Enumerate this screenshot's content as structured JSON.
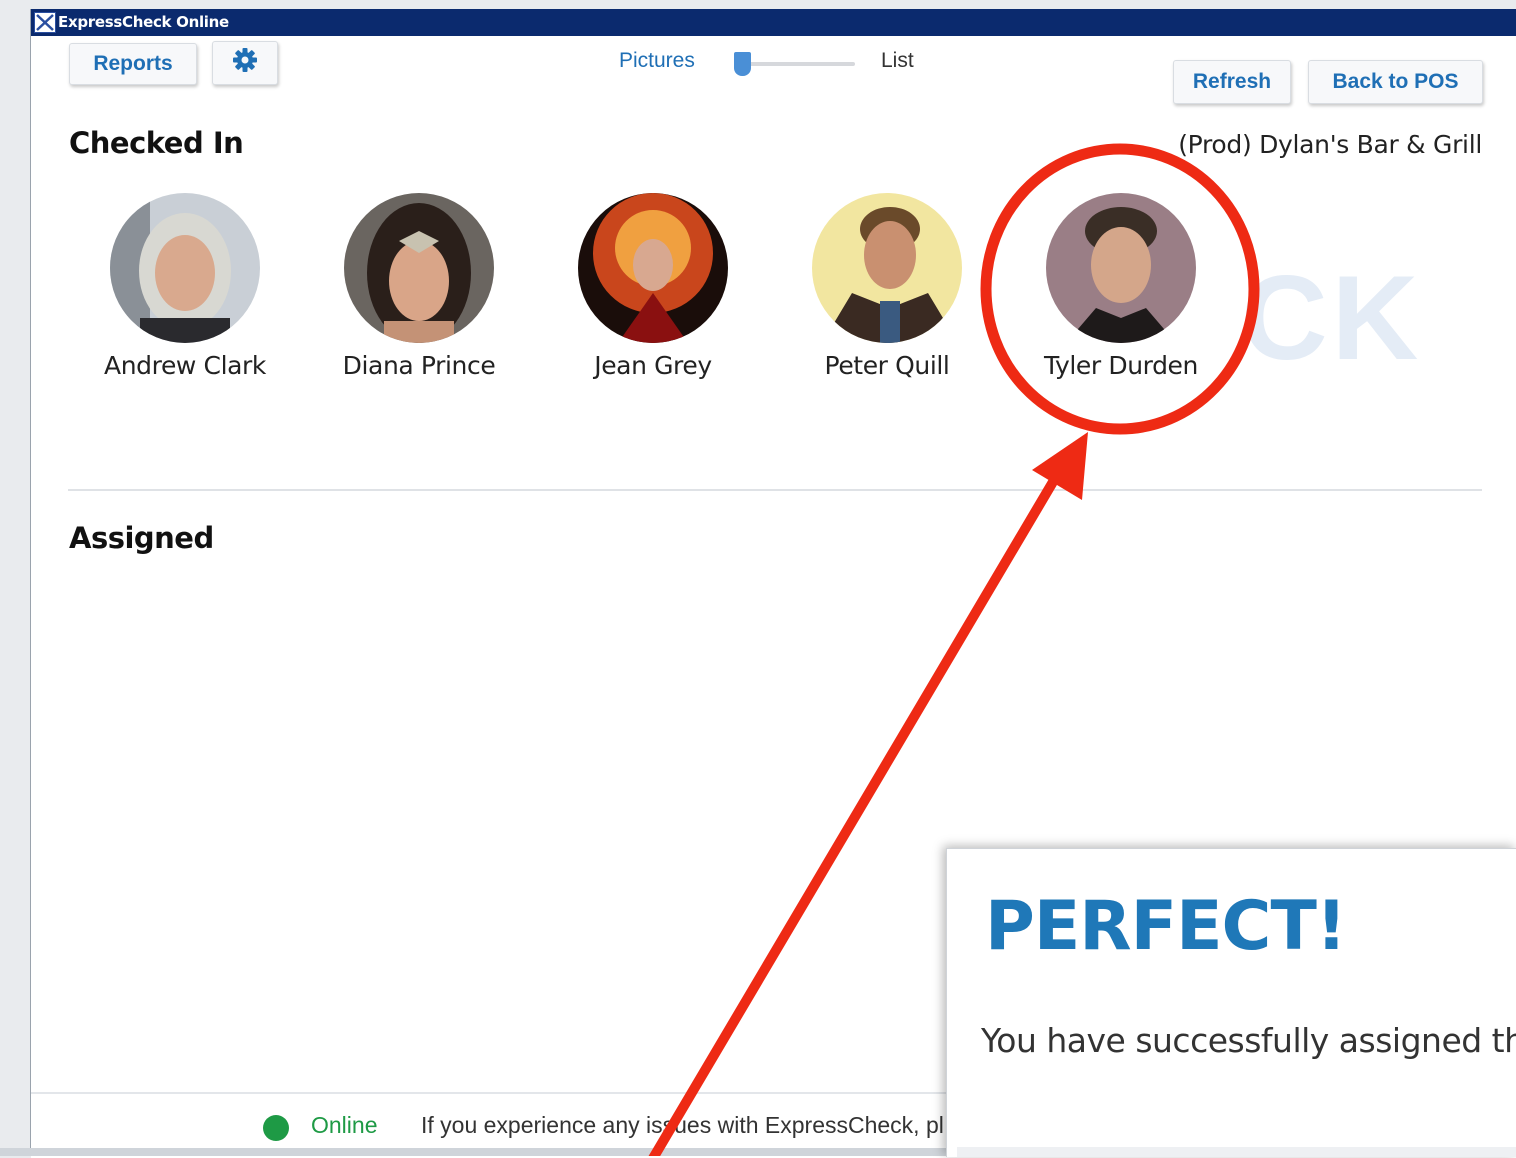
{
  "window": {
    "title": "ExpressCheck Online"
  },
  "toolbar": {
    "reports_label": "Reports",
    "settings_icon": "gear-icon",
    "view_toggle": {
      "left_label": "Pictures",
      "right_label": "List",
      "selected": "Pictures"
    },
    "refresh_label": "Refresh",
    "back_label": "Back to POS"
  },
  "venue": "(Prod) Dylan's Bar & Grill",
  "sections": {
    "checked_in": {
      "heading": "Checked In",
      "people": [
        {
          "name": "Andrew Clark"
        },
        {
          "name": "Diana Prince"
        },
        {
          "name": "Jean Grey"
        },
        {
          "name": "Peter Quill"
        },
        {
          "name": "Tyler Durden"
        }
      ]
    },
    "assigned": {
      "heading": "Assigned"
    }
  },
  "watermark": "CK",
  "footer": {
    "status": "Online",
    "notice": "If you experience any issues with ExpressCheck, pl"
  },
  "toast": {
    "title": "PERFECT!",
    "message": "You have successfully assigned this"
  },
  "colors": {
    "accent": "#1f6fb5",
    "titlebar": "#0b2a6e",
    "online": "#1e9a45",
    "annotation": "#ee2a14",
    "toast_title": "#1f78b8"
  }
}
